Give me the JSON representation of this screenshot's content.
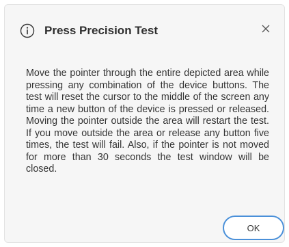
{
  "dialog": {
    "title": "Press Precision Test",
    "title_icon": "info-icon",
    "close_icon": "close-icon",
    "message": "Move the pointer through the entire depicted area while pressing any combination of the device buttons. The test will reset the cursor to the middle of the screen any time a new button of the device is pressed or released. Moving the pointer outside the area will restart the test. If you move outside the area or release any button five times, the test will fail. Also, if the pointer is not moved for more than 30 seconds the test window will be closed.",
    "ok_label": "OK"
  },
  "colors": {
    "dialog_background": "#f6f6f6",
    "accent_border": "#4a90d9",
    "text": "#333333"
  }
}
